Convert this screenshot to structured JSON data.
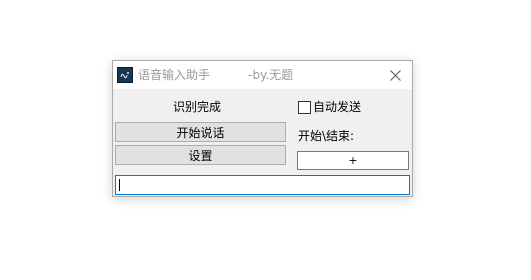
{
  "window": {
    "title": "语音输入助手          -by.无题",
    "icon": "app-logo-icon",
    "close_icon": "close-icon"
  },
  "main": {
    "status_text": "识别完成",
    "start_button_label": "开始说话",
    "settings_button_label": "设置",
    "auto_send_label": "自动发送",
    "auto_send_checked": false,
    "hotkey_label": "开始\\结束:",
    "hotkey_value": "+",
    "text_input_value": ""
  },
  "colors": {
    "focus_border": "#0078d7",
    "window_bg": "#f0f0f0",
    "button_bg": "#e1e1e1"
  }
}
